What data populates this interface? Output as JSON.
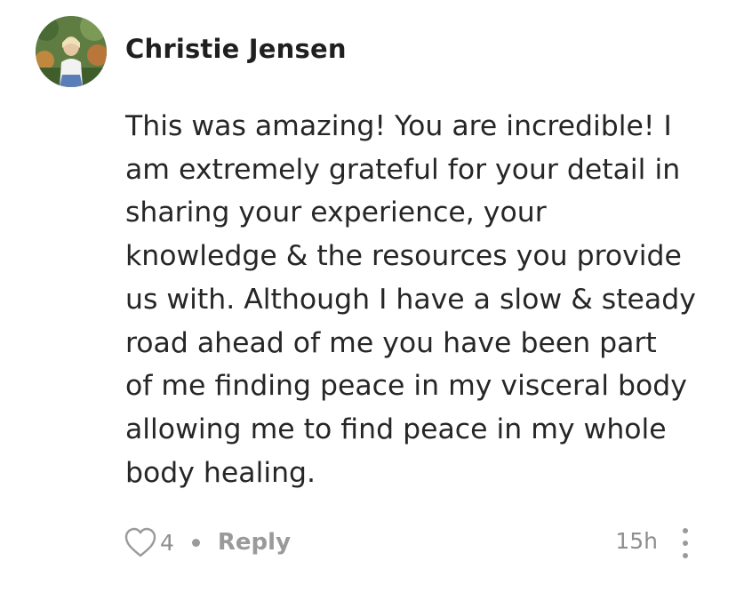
{
  "comment": {
    "author": "Christie Jensen",
    "avatar_icon": "profile-photo",
    "text": "This was amazing! You are incredible! I\nam extremely grateful for your detail in\nsharing your experience, your\nknowledge & the resources you provide\nus with. Although I have a slow & steady\nroad ahead of me you have been part\nof me finding peace in my visceral body\nallowing me to find peace in my whole\nbody healing.",
    "like_count": "4",
    "like_icon": "heart-outline-icon",
    "reply_label": "Reply",
    "timestamp": "15h",
    "more_icon": "vertical-ellipsis-icon"
  },
  "colors": {
    "text": "#262626",
    "muted": "#8e8e8e"
  }
}
